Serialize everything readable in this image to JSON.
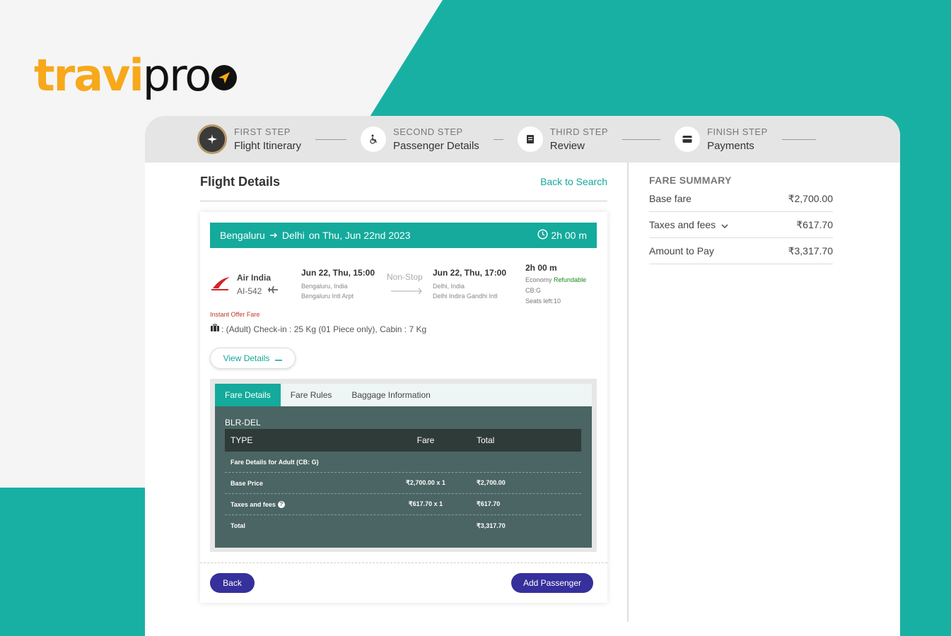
{
  "brand": {
    "part1": "travi",
    "part2": "pro"
  },
  "steps": [
    {
      "label": "FIRST STEP",
      "title": "Flight Itinerary",
      "icon": "airplane-icon",
      "active": true
    },
    {
      "label": "SECOND STEP",
      "title": "Passenger Details",
      "icon": "wheelchair-icon"
    },
    {
      "label": "THIRD STEP",
      "title": "Review",
      "icon": "document-icon"
    },
    {
      "label": "FINISH STEP",
      "title": "Payments",
      "icon": "card-icon"
    }
  ],
  "flight_details": {
    "title": "Flight Details",
    "back_link": "Back to Search",
    "route": {
      "from": "Bengaluru",
      "to": "Delhi",
      "date_text": "on Thu, Jun 22nd 2023",
      "duration": "2h 00 m"
    },
    "airline": {
      "name": "Air India",
      "flight_no": "AI-542"
    },
    "departure": {
      "time": "Jun 22, Thu, 15:00",
      "city": "Bengaluru, India",
      "airport": "Bengaluru Intl Arpt"
    },
    "stops": "Non-Stop",
    "arrival": {
      "time": "Jun 22, Thu, 17:00",
      "city": "Delhi, India",
      "airport": "Delhi Indira Gandhi Intl"
    },
    "meta": {
      "duration": "2h 00 m",
      "cabin": "Economy",
      "refund": "Refundable",
      "cb": "CB:G",
      "seats": "Seats left:10"
    },
    "offer": "Instant Offer Fare",
    "baggage": ": (Adult) Check-in : 25 Kg (01 Piece only), Cabin : 7 Kg",
    "view_details": "View Details"
  },
  "tabs": [
    "Fare Details",
    "Fare Rules",
    "Baggage Information"
  ],
  "fare_table": {
    "sector": "BLR-DEL",
    "headers": [
      "TYPE",
      "Fare",
      "Total"
    ],
    "section_label": "Fare Details for Adult (CB: G)",
    "rows": [
      {
        "type": "Base Price",
        "fare": "₹2,700.00 x 1",
        "total": "₹2,700.00"
      },
      {
        "type": "Taxes and fees",
        "fare": "₹617.70 x 1",
        "total": "₹617.70"
      },
      {
        "type": "Total",
        "fare": "",
        "total": "₹3,317.70"
      }
    ]
  },
  "buttons": {
    "back": "Back",
    "add_passenger": "Add Passenger"
  },
  "fare_summary": {
    "title": "FARE SUMMARY",
    "base_fare_label": "Base fare",
    "base_fare": "₹2,700.00",
    "taxes_label": "Taxes and fees",
    "taxes": "₹617.70",
    "amount_label": "Amount to Pay",
    "amount": "₹3,317.70"
  },
  "colors": {
    "teal": "#14aa9c",
    "accent_orange": "#f7a81b",
    "button": "#35309b"
  }
}
